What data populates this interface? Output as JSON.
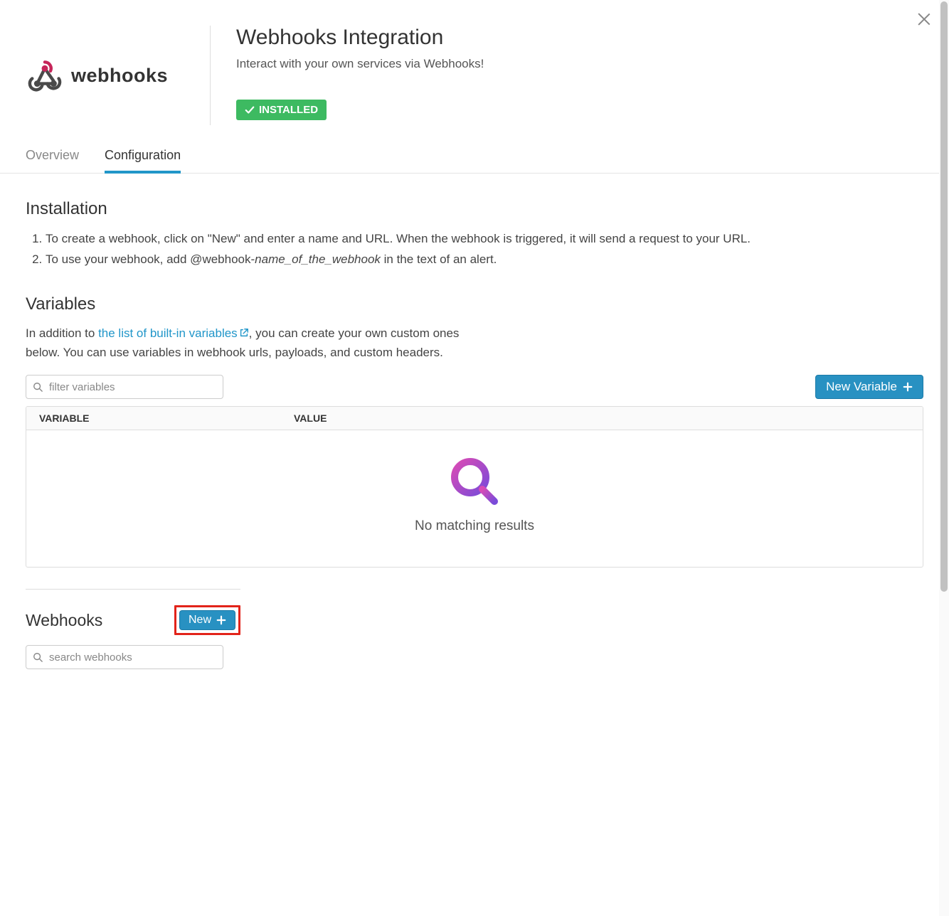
{
  "header": {
    "logo_text": "webhooks",
    "title": "Webhooks Integration",
    "subtitle": "Interact with your own services via Webhooks!",
    "installed_badge": "INSTALLED"
  },
  "tabs": [
    {
      "label": "Overview",
      "active": false
    },
    {
      "label": "Configuration",
      "active": true
    }
  ],
  "installation": {
    "title": "Installation",
    "steps": {
      "s1": "To create a webhook, click on \"New\" and enter a name and URL. When the webhook is triggered, it will send a request to your URL.",
      "s2_prefix": "To use your webhook, add @webhook-",
      "s2_emph": "name_of_the_webhook",
      "s2_suffix": " in the text of an alert."
    }
  },
  "variables": {
    "title": "Variables",
    "intro_prefix": "In addition to ",
    "intro_link": "the list of built-in variables",
    "intro_suffix": ", you can create your own custom ones below. You can use variables in webhook urls, payloads, and custom headers.",
    "filter_placeholder": "filter variables",
    "new_variable_label": "New Variable",
    "columns": {
      "variable": "VARIABLE",
      "value": "VALUE"
    },
    "empty_text": "No matching results"
  },
  "webhooks": {
    "title": "Webhooks",
    "new_label": "New",
    "search_placeholder": "search webhooks"
  }
}
